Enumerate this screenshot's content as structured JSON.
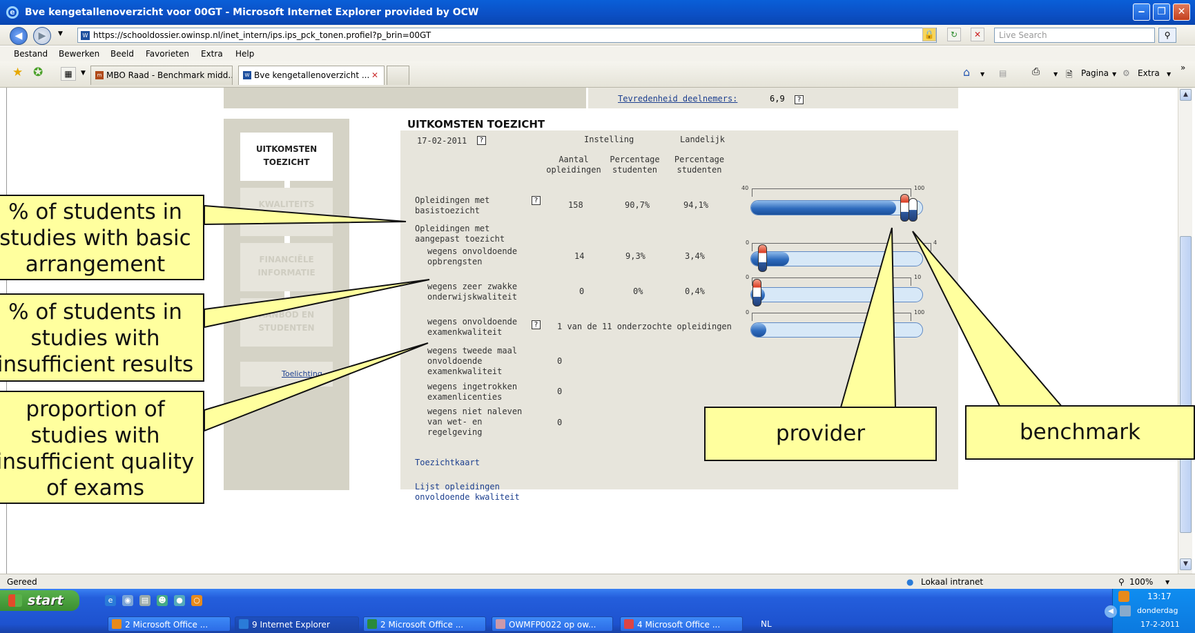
{
  "window": {
    "title": "Bve kengetallenoverzicht voor 00GT - Microsoft Internet Explorer provided by OCW",
    "min": "‒",
    "max": "❐",
    "close": "✕"
  },
  "address_bar": {
    "url": "https://schooldossier.owinsp.nl/inet_intern/ips.ips_pck_tonen.profiel?p_brin=00GT",
    "search_placeholder": "Live Search"
  },
  "menu": [
    "Bestand",
    "Bewerken",
    "Beeld",
    "Favorieten",
    "Extra",
    "Help"
  ],
  "tabs": [
    {
      "label": "MBO Raad - Benchmark midd..."
    },
    {
      "label": "Bve kengetallenoverzicht ...",
      "close": "✕"
    }
  ],
  "toolbar_right": {
    "page": "Pagina",
    "extra": "Extra"
  },
  "page": {
    "satisfaction": {
      "label": "Tevredenheid deelnemers:",
      "value": "6,9"
    },
    "sidenav": [
      {
        "label": "UITKOMSTEN TOEZICHT",
        "active": true
      },
      {
        "label": "KWALITEITS BEOORDELING",
        "active": false
      },
      {
        "label": "FINANCIËLE INFORMATIE",
        "active": false
      },
      {
        "label": "AANBOD EN STUDENTEN",
        "active": false
      }
    ],
    "toelichting": "Toelichting",
    "section_title": "UITKOMSTEN TOEZICHT",
    "date": "17-02-2011",
    "col_instelling": "Instelling",
    "col_landelijk": "Landelijk",
    "col_aantal": "Aantal opleidingen",
    "col_perc_inst": "Percentage studenten",
    "col_perc_land": "Percentage studenten",
    "rows": [
      {
        "label": "Opleidingen met basistoezicht",
        "aantal": "158",
        "inst": "90,7%",
        "land": "94,1%",
        "help": true
      },
      {
        "label": "Opleidingen met aangepast toezicht"
      },
      {
        "label": "wegens onvoldoende opbrengsten",
        "aantal": "14",
        "inst": "9,3%",
        "land": "3,4%"
      },
      {
        "label": "wegens zeer zwakke onderwijskwaliteit",
        "aantal": "0",
        "inst": "0%",
        "land": "0,4%"
      },
      {
        "label": "wegens onvoldoende examenkwaliteit",
        "aantal": "1 van de 11 onderzochte opleidingen",
        "help": true
      },
      {
        "label": "wegens tweede maal onvoldoende examenkwaliteit",
        "aantal": "0"
      },
      {
        "label": "wegens ingetrokken examenlicenties",
        "aantal": "0"
      },
      {
        "label": "wegens niet naleven van wet- en regelgeving",
        "aantal": "0"
      }
    ],
    "bars": [
      {
        "min": "40",
        "max": "100",
        "fill": 0.845,
        "inst_pos": 0.845,
        "land_pos": 0.902
      },
      {
        "min": "0",
        "max": "4",
        "fill": 0.22,
        "inst_pos": 0.0,
        "land_pos": 0.0
      },
      {
        "min": "0",
        "max": "10",
        "fill": 0.0,
        "inst_pos": 0.0,
        "land_pos": 0.0
      },
      {
        "min": "0",
        "max": "100",
        "fill": 0.09
      }
    ],
    "links": [
      "Toezichtkaart",
      "Lijst opleidingen onvoldoende kwaliteit"
    ]
  },
  "callouts": {
    "c1": "% of students in studies with basic arrangement",
    "c2": "% of students in studies with insufficient results",
    "c3": "proportion of studies with insufficient quality of exams",
    "c4": "provider",
    "c5": "benchmark"
  },
  "status": {
    "text": "Gereed",
    "zone": "Lokaal intranet",
    "zoom": "100%"
  },
  "taskbar": {
    "start": "start",
    "items": [
      "2 Microsoft Office ...",
      "9 Internet Explorer",
      "2 Microsoft Office ...",
      "OWMFP0022 op ow...",
      "4 Microsoft Office ..."
    ],
    "lang": "NL",
    "time": "13:17",
    "day": "donderdag",
    "date": "17-2-2011"
  },
  "colors": {
    "callout": "#ffff9e",
    "panel": "#e7e5dc",
    "nav": "#d5d3c6",
    "link": "#1c3f8f"
  }
}
